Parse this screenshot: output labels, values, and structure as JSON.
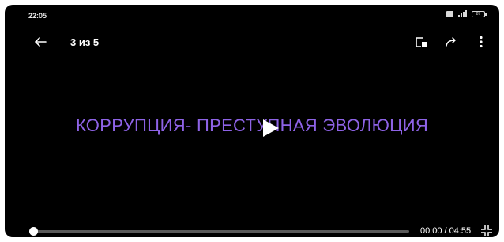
{
  "status_bar": {
    "time": "22:05",
    "battery": "87",
    "icons": [
      "message-icon",
      "signal-icon",
      "battery-icon"
    ]
  },
  "top_bar": {
    "counter": "3 из 5",
    "icons": [
      "back-arrow-icon",
      "cast-icon",
      "share-icon",
      "more-vert-icon"
    ]
  },
  "video": {
    "title": "КОРРУПЦИЯ- ПРЕСТУПНАЯ ЭВОЛЮЦИЯ",
    "title_color": "#8e63e6",
    "state": "paused"
  },
  "controls": {
    "current_time": "00:00",
    "separator": "/",
    "duration": "04:55",
    "progress": 0.0,
    "exit_fullscreen_icon": "fullscreen-exit-icon"
  }
}
